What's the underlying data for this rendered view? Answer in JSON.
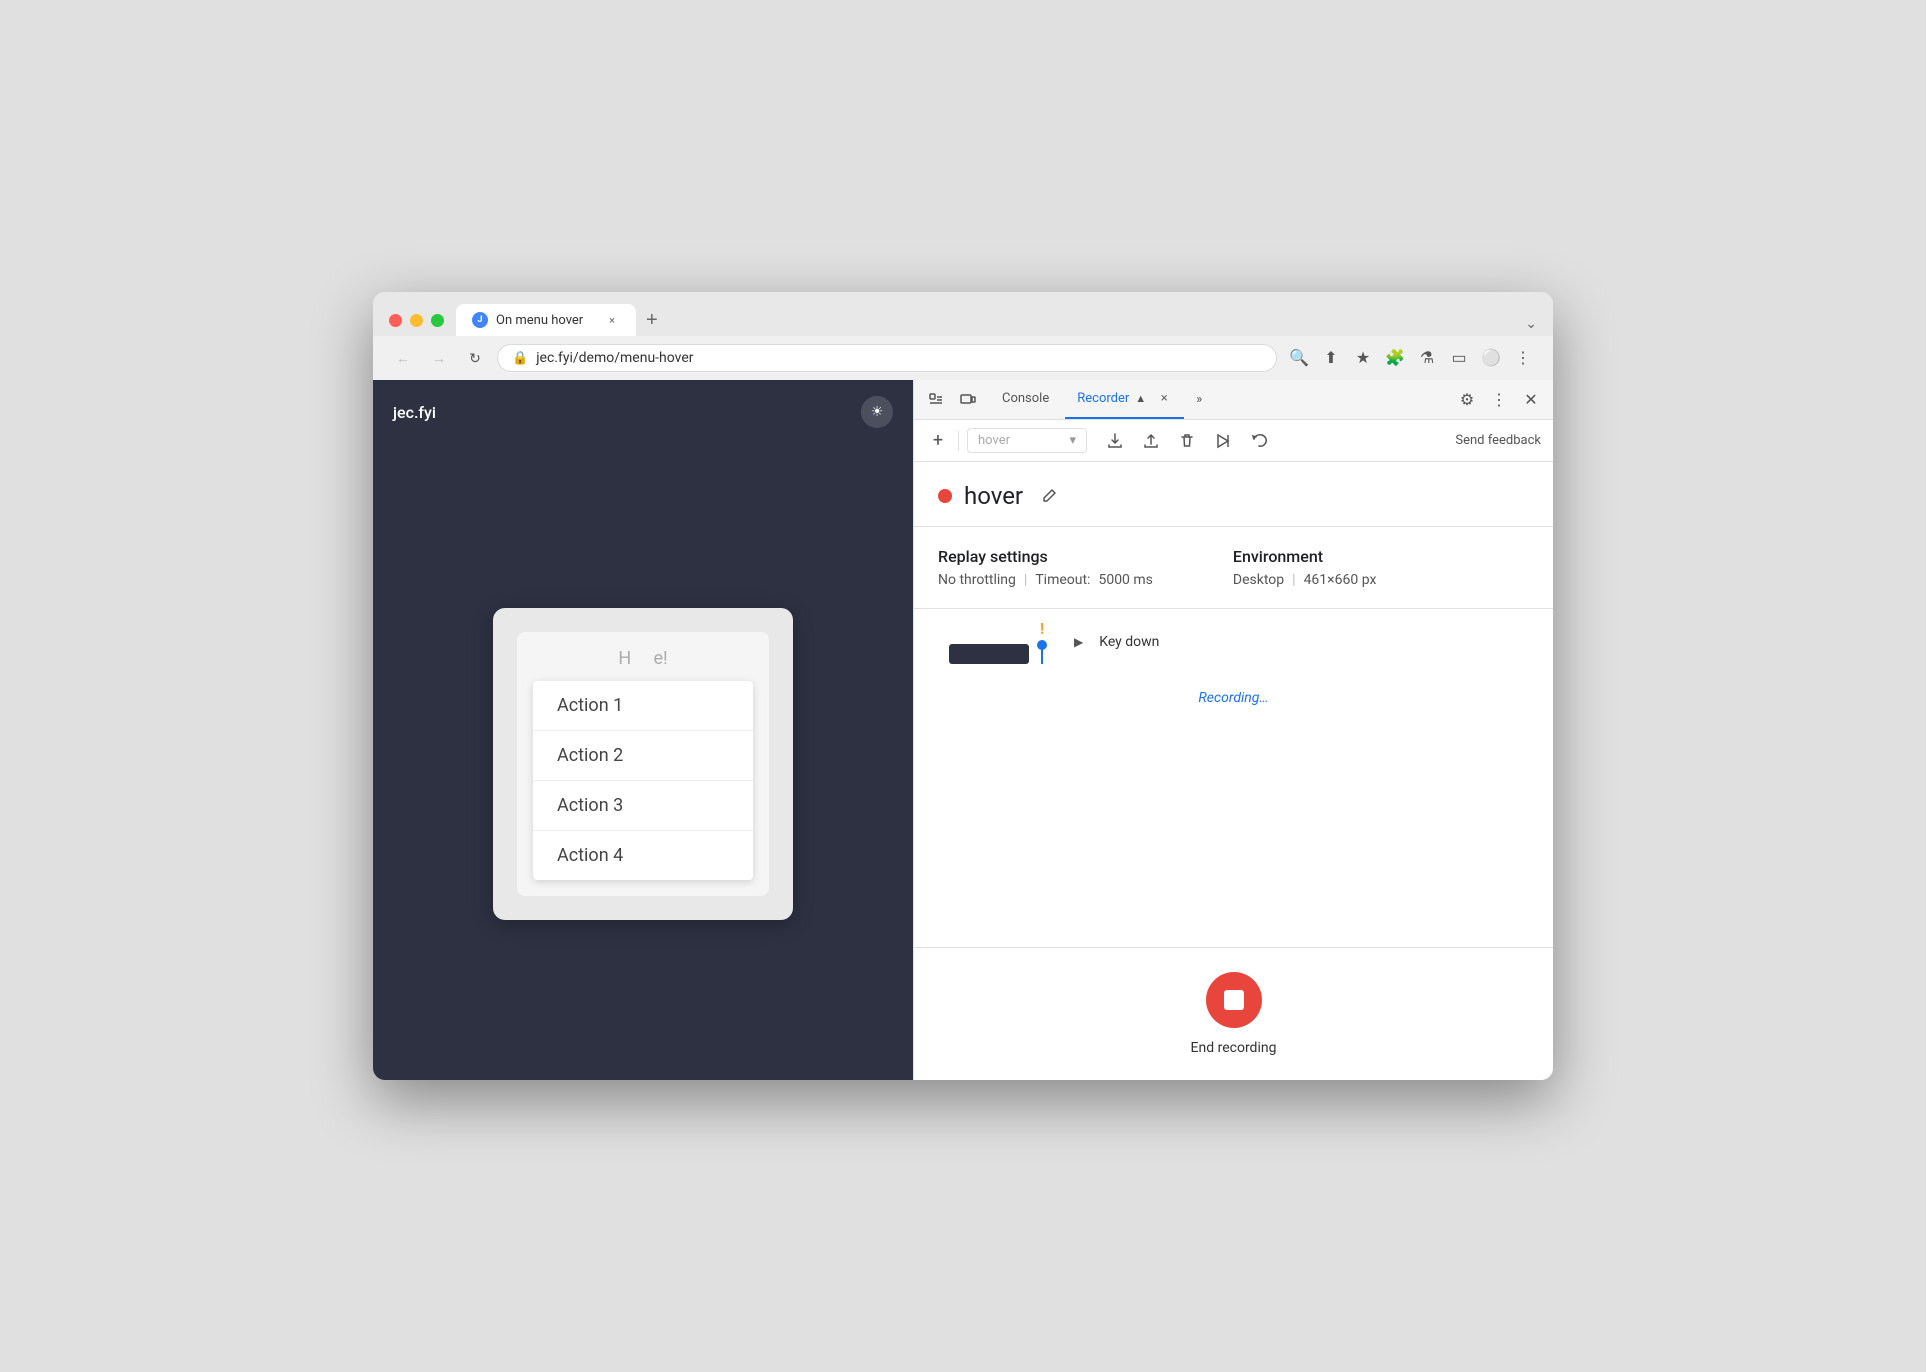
{
  "browser": {
    "traffic_lights": [
      "close",
      "minimize",
      "maximize"
    ],
    "tab": {
      "favicon_text": "J",
      "label": "On menu hover",
      "close_label": "×"
    },
    "new_tab_label": "+",
    "address": "jec.fyi/demo/menu-hover",
    "nav_buttons": {
      "back": "←",
      "forward": "→",
      "reload": "↻"
    }
  },
  "website": {
    "logo": "jec.fyi",
    "theme_icon": "☀",
    "card_text": "H     e!",
    "menu_items": [
      "Action 1",
      "Action 2",
      "Action 3",
      "Action 4"
    ]
  },
  "devtools": {
    "tabs": [
      {
        "label": "Console",
        "active": false
      },
      {
        "label": "Recorder",
        "active": true
      },
      {
        "label": "⚑",
        "active": false
      }
    ],
    "recorder_close": "×",
    "more_tabs": "»",
    "toolbar": {
      "add_label": "+",
      "dropdown_placeholder": "hover",
      "dropdown_arrow": "▾",
      "send_feedback": "Send feedback",
      "action_icons": [
        "⇧",
        "⇩",
        "🗑",
        "▷❙",
        "↩"
      ]
    },
    "recording": {
      "name": "hover",
      "edit_icon": "✎",
      "dot_color": "#e8453c"
    },
    "replay_settings": {
      "title": "Replay settings",
      "throttling": "No throttling",
      "timeout_label": "Timeout:",
      "timeout_value": "5000 ms"
    },
    "environment": {
      "title": "Environment",
      "device": "Desktop",
      "dimensions": "461×660 px"
    },
    "step": {
      "key_down_label": "Key down",
      "expand_icon": "▶"
    },
    "recording_status": "Recording…",
    "end_recording": {
      "label": "End recording"
    }
  }
}
